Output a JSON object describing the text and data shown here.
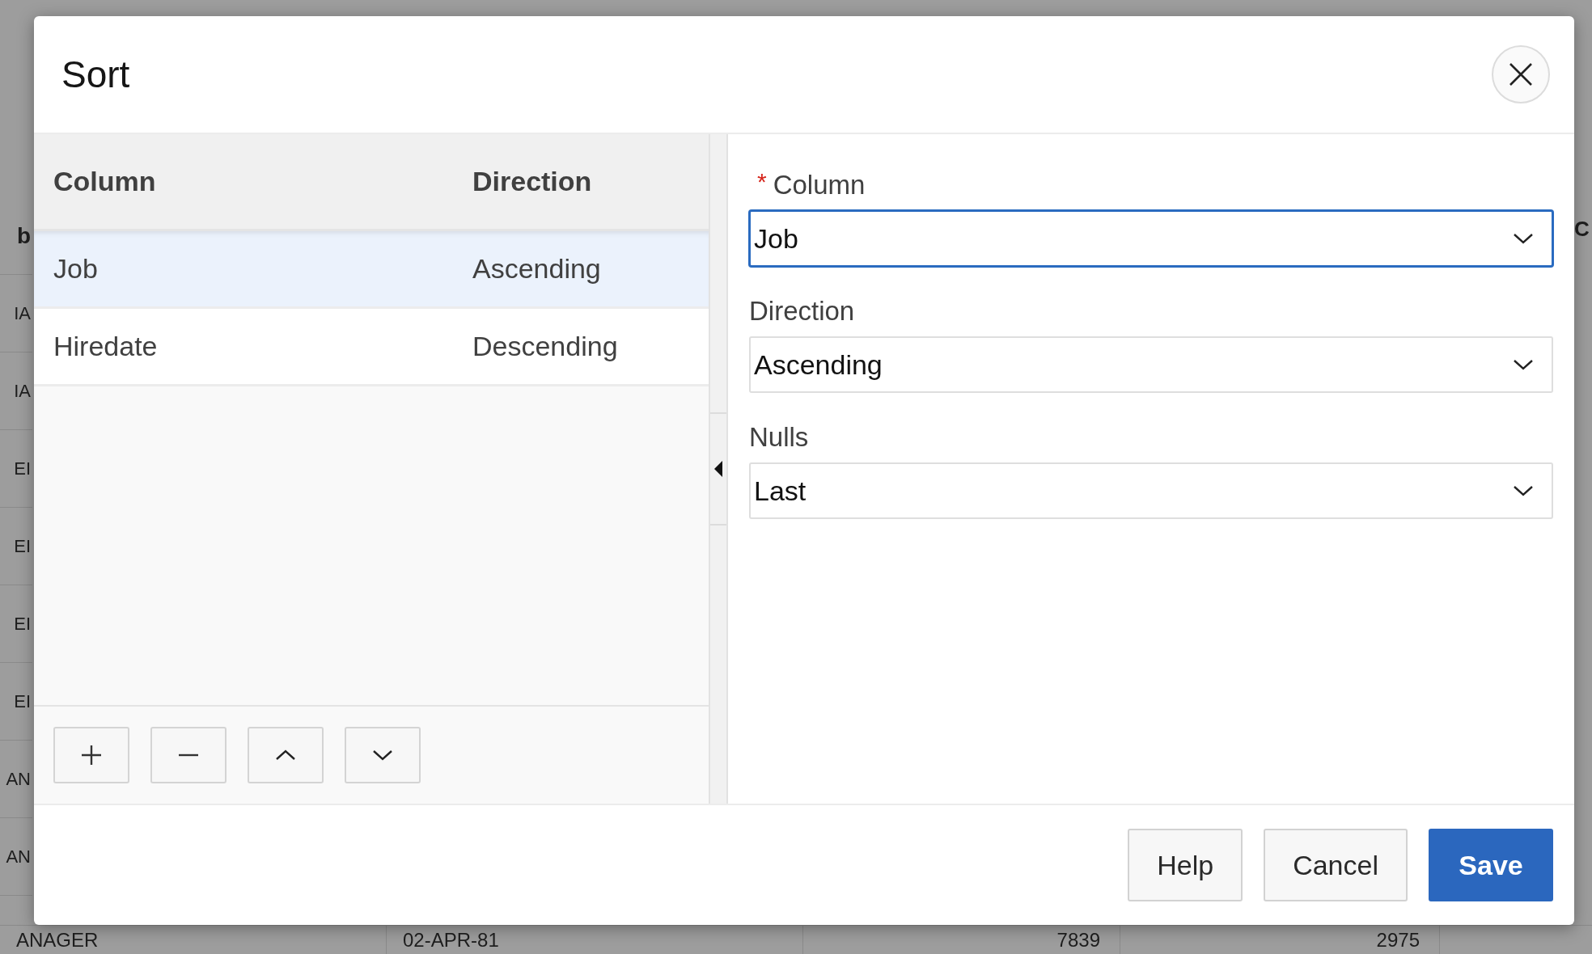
{
  "background_table": {
    "left_column": [
      {
        "text": "b",
        "kind": "header"
      },
      {
        "text": "IA",
        "kind": "cell"
      },
      {
        "text": "IA",
        "kind": "cell"
      },
      {
        "text": "EI",
        "kind": "cell"
      },
      {
        "text": "EI",
        "kind": "cell"
      },
      {
        "text": "EI",
        "kind": "cell"
      },
      {
        "text": "EI",
        "kind": "cell"
      },
      {
        "text": "AN",
        "kind": "cell"
      },
      {
        "text": "AN",
        "kind": "cell"
      }
    ],
    "right_header": "C",
    "bottom_row": [
      "ANAGER",
      "02-APR-81",
      "7839",
      "2975"
    ]
  },
  "dialog": {
    "title": "Sort",
    "sort_list": {
      "columns": [
        "Column",
        "Direction"
      ],
      "rows": [
        {
          "column": "Job",
          "direction": "Ascending",
          "selected": true
        },
        {
          "column": "Hiredate",
          "direction": "Descending",
          "selected": false
        }
      ],
      "toolbar": [
        {
          "kind": "add"
        },
        {
          "kind": "remove"
        },
        {
          "kind": "up"
        },
        {
          "kind": "down"
        }
      ]
    },
    "fields": [
      {
        "required_mark": "*",
        "label": "Column",
        "value": "Job",
        "focused": true
      },
      {
        "label": "Direction",
        "value": "Ascending",
        "focused": false
      },
      {
        "label": "Nulls",
        "value": "Last",
        "focused": false
      }
    ],
    "buttons": [
      {
        "label": "Help",
        "kind": "default"
      },
      {
        "label": "Cancel",
        "kind": "default"
      },
      {
        "label": "Save",
        "kind": "primary"
      }
    ]
  }
}
